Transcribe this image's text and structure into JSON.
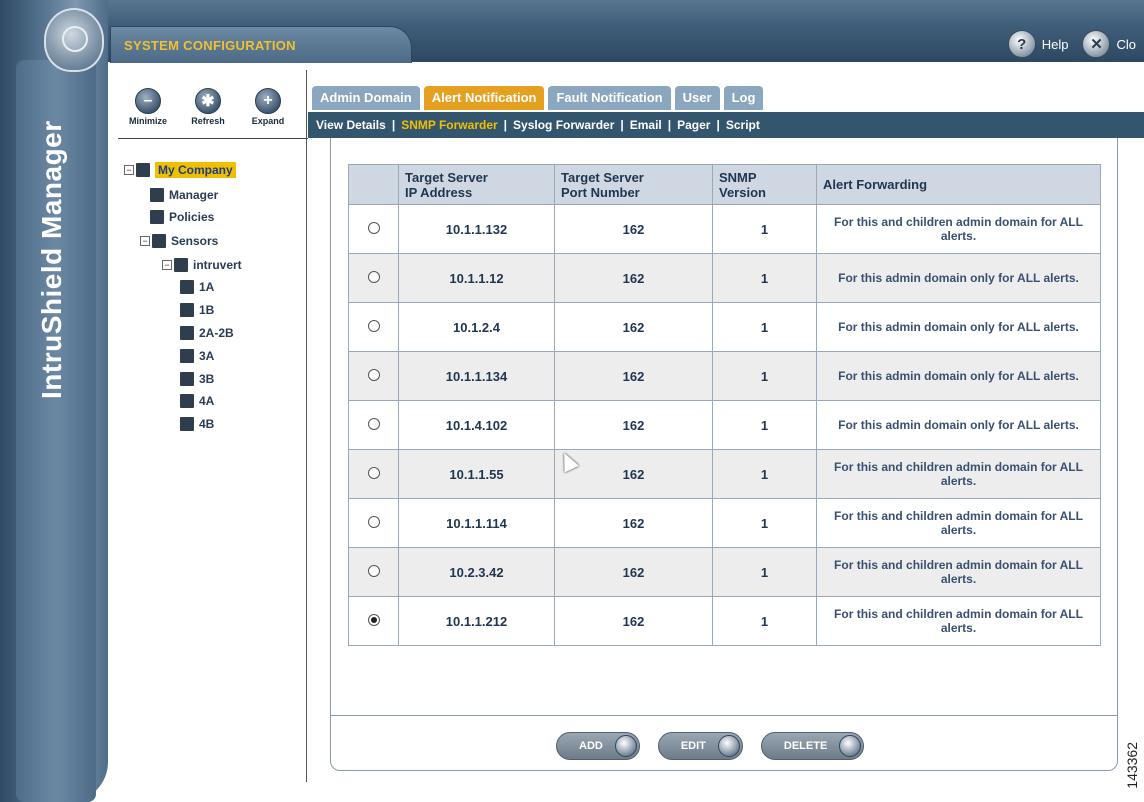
{
  "app": {
    "vertical_title": "IntruShield Manager",
    "section_title": "SYSTEM CONFIGURATION",
    "help_label": "Help",
    "close_label": "Clo",
    "figure_number": "143362"
  },
  "toolbar": {
    "minimize": "Minimize",
    "refresh": "Refresh",
    "expand": "Expand"
  },
  "tree": [
    {
      "label": "My Company",
      "toggle": "⊟",
      "level": 0,
      "icon": "building-icon",
      "selected": true
    },
    {
      "label": "Manager",
      "toggle": "",
      "level": 1,
      "icon": "server-icon"
    },
    {
      "label": "Policies",
      "toggle": "",
      "level": 1,
      "icon": "policy-icon"
    },
    {
      "label": "Sensors",
      "toggle": "⊟",
      "level": 1,
      "icon": "sensors-icon"
    },
    {
      "label": "intruvert",
      "toggle": "⊟",
      "level": 2,
      "icon": "sensor-device-icon"
    },
    {
      "label": "1A",
      "toggle": "",
      "level": 3,
      "icon": "port-icon"
    },
    {
      "label": "1B",
      "toggle": "",
      "level": 3,
      "icon": "port-icon"
    },
    {
      "label": "2A-2B",
      "toggle": "",
      "level": 3,
      "icon": "port-icon"
    },
    {
      "label": "3A",
      "toggle": "",
      "level": 3,
      "icon": "port-icon"
    },
    {
      "label": "3B",
      "toggle": "",
      "level": 3,
      "icon": "port-icon"
    },
    {
      "label": "4A",
      "toggle": "",
      "level": 3,
      "icon": "port-icon"
    },
    {
      "label": "4B",
      "toggle": "",
      "level": 3,
      "icon": "port-icon"
    }
  ],
  "tabs": [
    "Admin Domain",
    "Alert Notification",
    "Fault Notification",
    "User",
    "Log"
  ],
  "active_tab": "Alert Notification",
  "subnav": [
    "View Details",
    "SNMP Forwarder",
    "Syslog Forwarder",
    "Email",
    "Pager",
    "Script"
  ],
  "active_subnav": "SNMP Forwarder",
  "table": {
    "headers": [
      "",
      "Target Server\nIP Address",
      "Target Server\nPort Number",
      "SNMP\nVersion",
      "Alert Forwarding"
    ],
    "rows": [
      {
        "ip": "10.1.1.132",
        "port": "162",
        "version": "1",
        "forwarding": "For this and children admin domain for ALL alerts.",
        "selected": false
      },
      {
        "ip": "10.1.1.12",
        "port": "162",
        "version": "1",
        "forwarding": "For this admin domain only for ALL alerts.",
        "selected": false
      },
      {
        "ip": "10.1.2.4",
        "port": "162",
        "version": "1",
        "forwarding": "For this admin domain only for ALL alerts.",
        "selected": false
      },
      {
        "ip": "10.1.1.134",
        "port": "162",
        "version": "1",
        "forwarding": "For this admin domain only for ALL alerts.",
        "selected": false
      },
      {
        "ip": "10.1.4.102",
        "port": "162",
        "version": "1",
        "forwarding": "For this admin domain only for ALL alerts.",
        "selected": false
      },
      {
        "ip": "10.1.1.55",
        "port": "162",
        "version": "1",
        "forwarding": "For this and children admin domain for ALL alerts.",
        "selected": false
      },
      {
        "ip": "10.1.1.114",
        "port": "162",
        "version": "1",
        "forwarding": "For this and children admin domain for ALL alerts.",
        "selected": false
      },
      {
        "ip": "10.2.3.42",
        "port": "162",
        "version": "1",
        "forwarding": "For this and children admin domain for ALL alerts.",
        "selected": false
      },
      {
        "ip": "10.1.1.212",
        "port": "162",
        "version": "1",
        "forwarding": "For this and children admin domain for ALL alerts.",
        "selected": true
      }
    ]
  },
  "buttons": {
    "add": "ADD",
    "edit": "EDIT",
    "delete": "DELETE"
  },
  "colors": {
    "accent": "#e6a020",
    "nav": "#34556e",
    "tab": "#8ba6bf",
    "highlight": "#f0c000"
  }
}
